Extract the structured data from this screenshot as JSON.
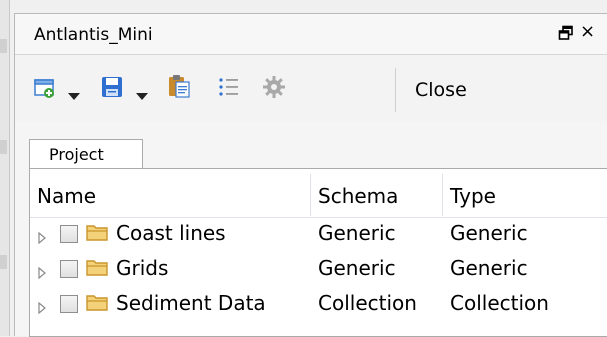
{
  "panel": {
    "title": "Antlantis_Mini",
    "float_icon": "float-window-icon",
    "close_glyph": "×"
  },
  "toolbar": {
    "items": [
      {
        "icon": "new-window-icon"
      },
      {
        "icon": "dropdown-arrow-icon"
      },
      {
        "icon": "save-disk-icon"
      },
      {
        "icon": "dropdown-arrow-icon"
      },
      {
        "icon": "clipboard-paste-icon"
      },
      {
        "icon": "list-icon"
      },
      {
        "icon": "gear-icon"
      }
    ],
    "close_label": "Close"
  },
  "tabs": [
    {
      "label": "Project",
      "active": true
    }
  ],
  "tree": {
    "columns": [
      "Name",
      "Schema",
      "Type"
    ],
    "rows": [
      {
        "name": "Coast lines",
        "schema": "Generic",
        "type": "Generic"
      },
      {
        "name": "Grids",
        "schema": "Generic",
        "type": "Generic"
      },
      {
        "name": "Sediment Data",
        "schema": "Collection",
        "type": "Collection"
      }
    ]
  },
  "colors": {
    "folder": "#e8b84a",
    "save_blue": "#2f6fd0",
    "new_green": "#3da23a"
  }
}
